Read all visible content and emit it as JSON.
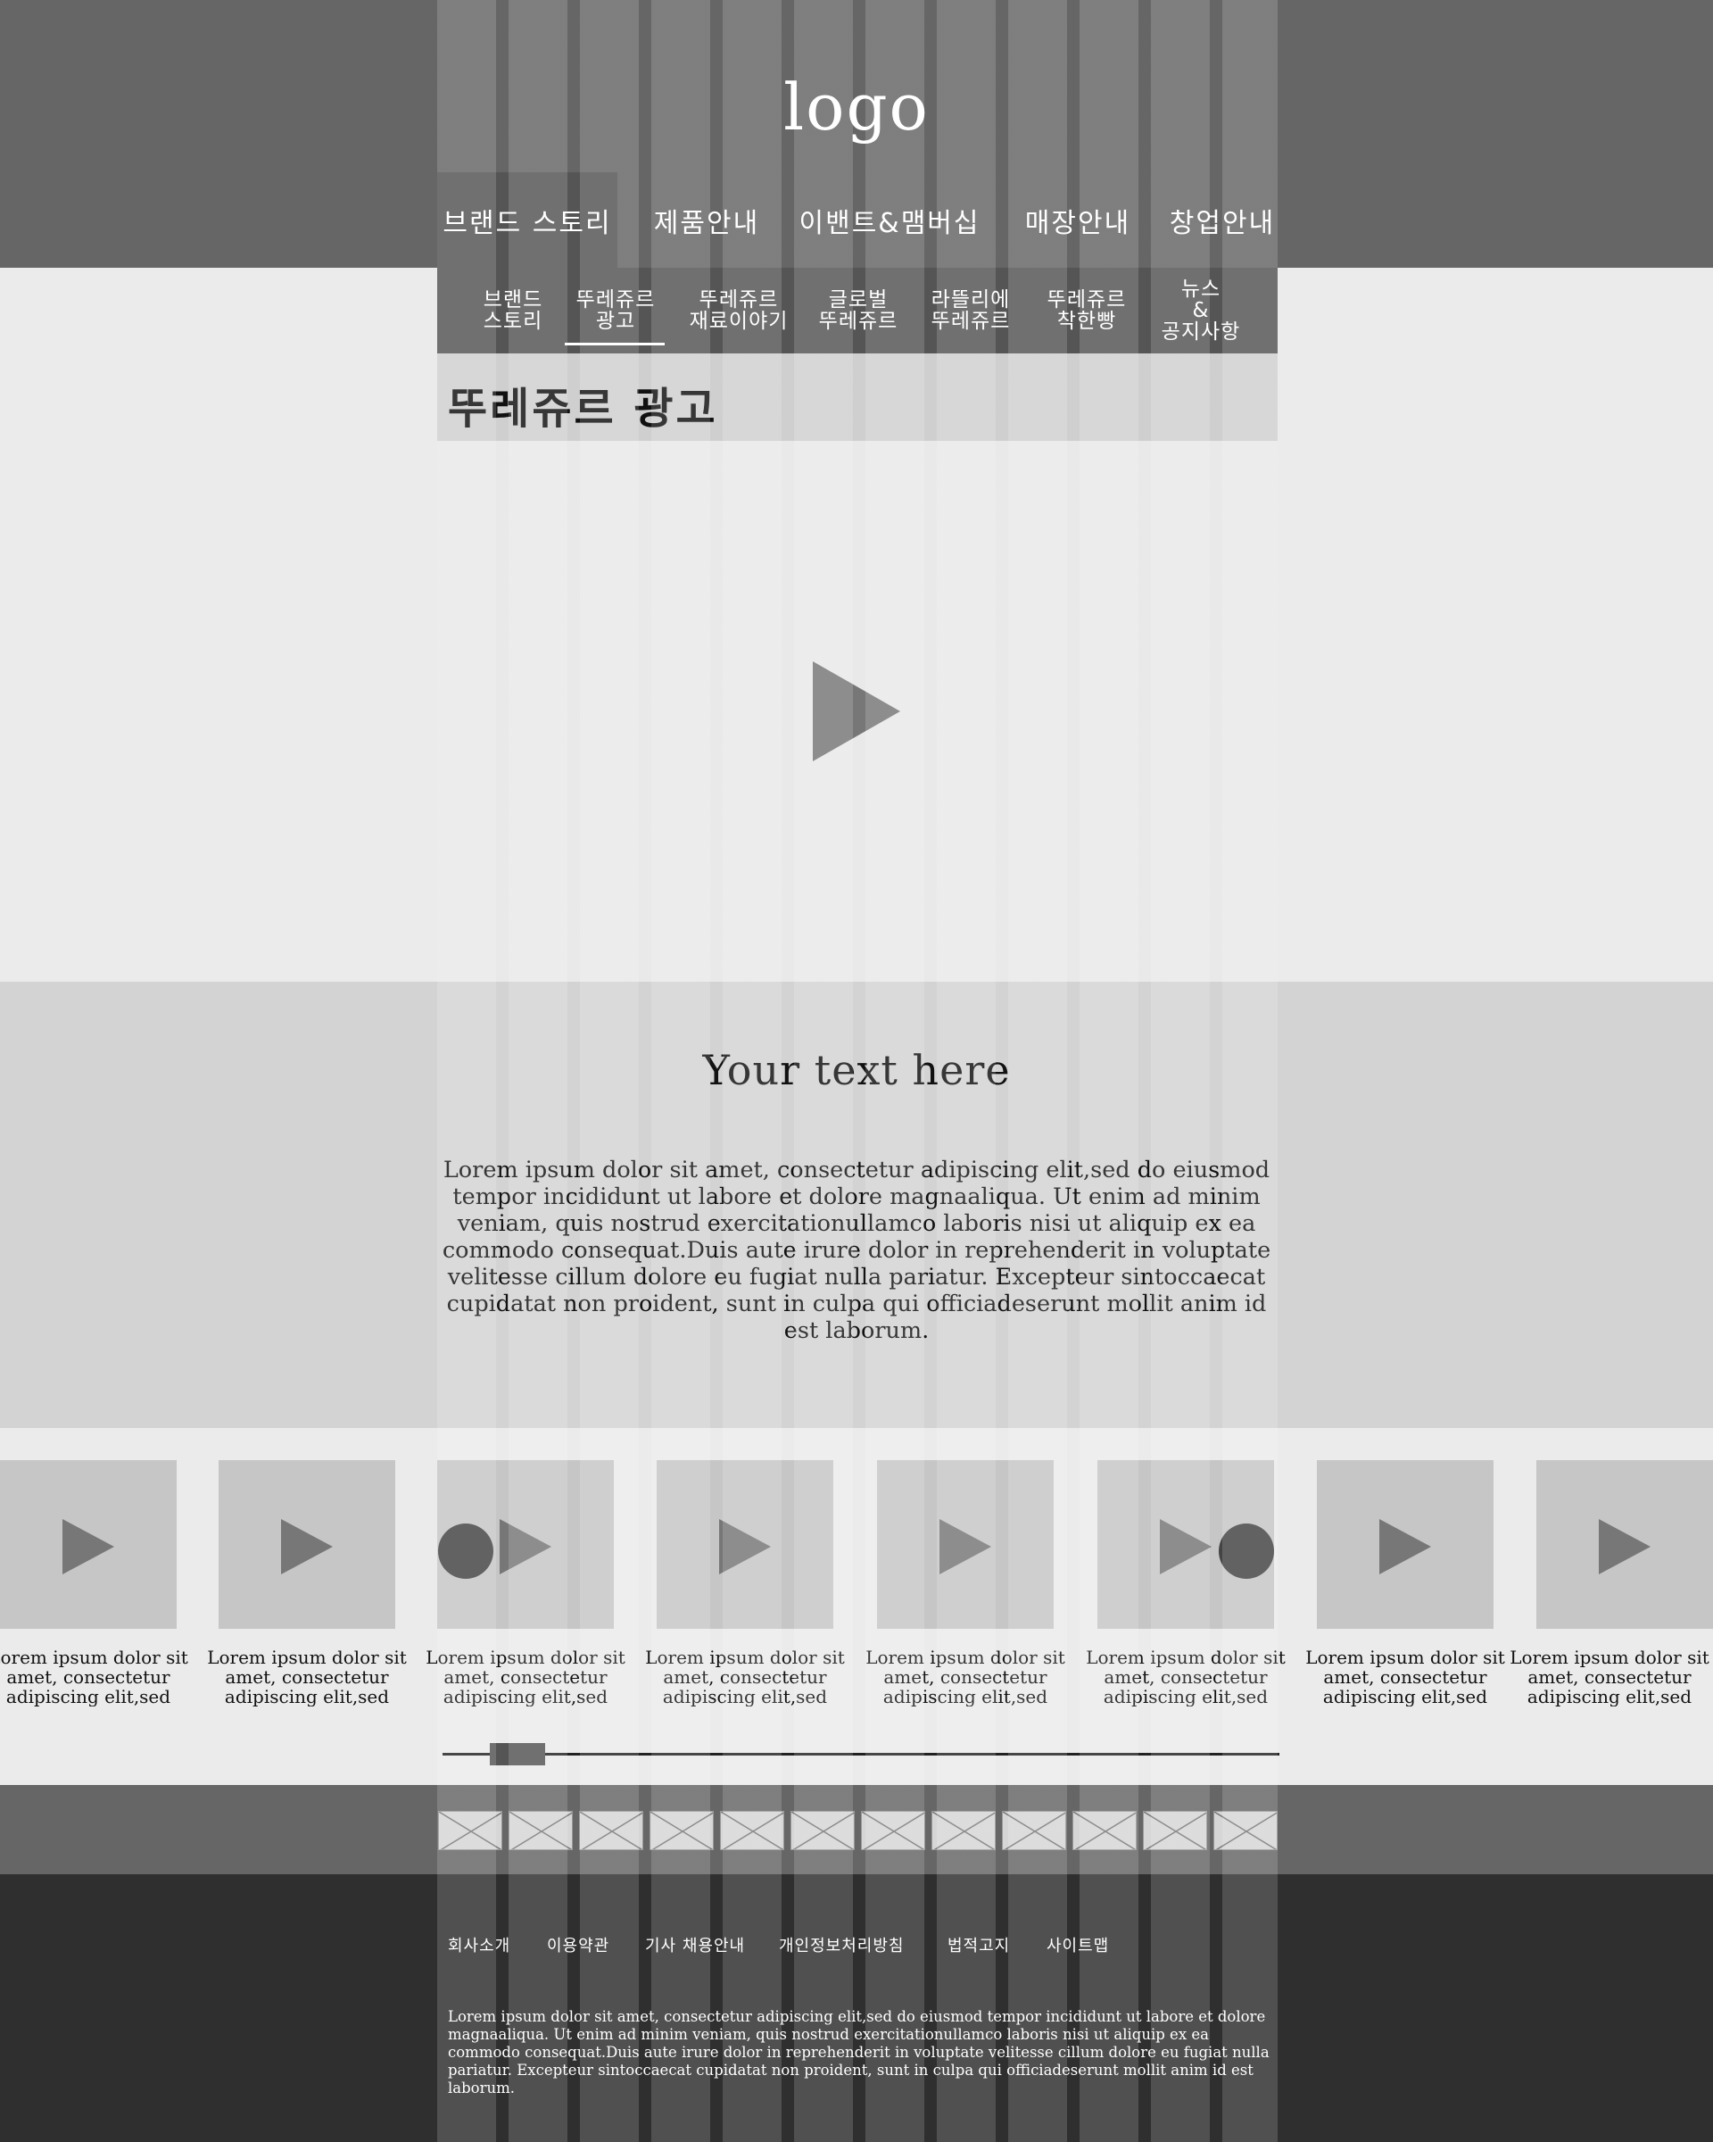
{
  "header": {
    "logo": "logo",
    "nav": [
      "브랜드 스토리",
      "제품안내",
      "이밴트&맴버십",
      "매장안내",
      "창업안내"
    ],
    "active_nav": "브랜드 스토리"
  },
  "subnav": {
    "items": [
      "브랜드\n스토리",
      "뚜레쥬르\n광고",
      "뚜레쥬르\n재료이야기",
      "글로벌\n뚜레쥬르",
      "라뜰리에\n뚜레쥬르",
      "뚜레쥬르\n착한빵",
      "뉴스\n&\n공지사항"
    ],
    "active_index": 1
  },
  "page_title": "뚜레쥬르 광고",
  "video": {
    "icon": "play-icon"
  },
  "text_section": {
    "heading": "Your text here",
    "body": "Lorem ipsum dolor sit amet, consectetur adipiscing elit,sed do eiusmod tempor incididunt ut labore et dolore magnaaliqua. Ut enim ad minim veniam, quis nostrud exercitationullamco laboris nisi ut aliquip ex ea commodo consequat.Duis aute irure dolor in reprehenderit in voluptate velitesse cillum dolore eu fugiat nulla pariatur. Excepteur sintoccaecat cupidatat non proident, sunt in culpa qui officiadeserunt mollit anim id est laborum."
  },
  "thumbnails": [
    {
      "caption": "Lorem ipsum dolor sit amet, consectetur adipiscing elit,sed"
    },
    {
      "caption": "Lorem ipsum dolor sit amet, consectetur adipiscing elit,sed"
    },
    {
      "caption": "Lorem ipsum dolor sit amet, consectetur adipiscing elit,sed"
    },
    {
      "caption": "Lorem ipsum dolor sit amet, consectetur adipiscing elit,sed"
    },
    {
      "caption": "Lorem ipsum dolor sit amet, consectetur adipiscing elit,sed"
    },
    {
      "caption": "Lorem ipsum dolor sit amet, consectetur adipiscing elit,sed"
    },
    {
      "caption": "Lorem ipsum dolor sit amet, consectetur adipiscing elit,sed"
    },
    {
      "caption": "Lorem ipsum dolor sit amet, consectetur adipiscing elit,sed"
    }
  ],
  "carousel": {
    "prev_icon": "prev-arrow-icon",
    "next_icon": "next-arrow-icon",
    "scroll_position": 0.06
  },
  "partners": {
    "count": 12,
    "icon": "image-placeholder-icon"
  },
  "footer": {
    "links": [
      "회사소개",
      "이용약관",
      "기사 채용안내",
      "개인정보처리방침",
      "법적고지",
      "사이트맵"
    ],
    "text": "Lorem ipsum dolor sit amet, consectetur adipiscing elit,sed do eiusmod tempor incididunt ut labore et dolore magnaaliqua. Ut enim ad minim veniam, quis nostrud exercitationullamco laboris nisi ut aliquip ex ea commodo consequat.Duis aute irure dolor in reprehenderit in voluptate velitesse cillum dolore eu fugiat nulla pariatur. Excepteur sintoccaecat cupidatat non proident, sunt in culpa qui officiadeserunt mollit anim id est laborum."
  },
  "colors": {
    "header": "#666666",
    "subnav": "#555555",
    "footer": "#2f2f2f",
    "accent": "#777777"
  }
}
